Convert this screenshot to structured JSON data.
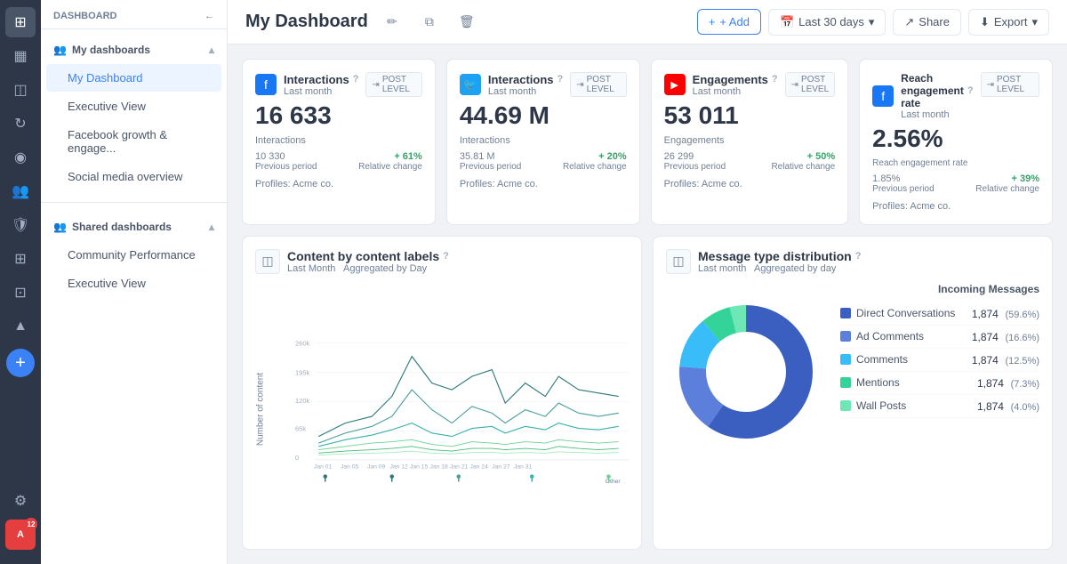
{
  "app": {
    "section_label": "DASHBOARD",
    "back_icon": "←"
  },
  "sidebar": {
    "my_dashboards_label": "My dashboards",
    "shared_dashboards_label": "Shared dashboards",
    "my_dashboard_items": [
      {
        "label": "My Dashboard",
        "active": true
      },
      {
        "label": "Executive View",
        "active": false
      },
      {
        "label": "Facebook growth & engage...",
        "active": false
      },
      {
        "label": "Social media overview",
        "active": false
      }
    ],
    "shared_dashboard_items": [
      {
        "label": "Community Performance",
        "active": false
      },
      {
        "label": "Executive View",
        "active": false
      }
    ]
  },
  "topbar": {
    "title": "My Dashboard",
    "add_label": "+ Add",
    "date_range_label": "Last 30 days",
    "share_label": "Share",
    "export_label": "Export"
  },
  "metrics": [
    {
      "icon_type": "facebook",
      "icon_text": "f",
      "title": "Interactions",
      "help": "?",
      "subtitle": "Last month",
      "badge": "POST LEVEL",
      "value": "16 633",
      "value_label": "Interactions",
      "prev_value": "10 330",
      "prev_label": "Previous period",
      "change": "+ 61%",
      "change_label": "Relative change",
      "profiles": "Profiles: Acme co."
    },
    {
      "icon_type": "twitter",
      "icon_text": "🐦",
      "title": "Interactions",
      "help": "?",
      "subtitle": "Last month",
      "badge": "POST LEVEL",
      "value": "44.69 M",
      "value_label": "Interactions",
      "prev_value": "35.81 M",
      "prev_label": "Previous period",
      "change": "+ 20%",
      "change_label": "Relative change",
      "profiles": "Profiles: Acme co."
    },
    {
      "icon_type": "youtube",
      "icon_text": "▶",
      "title": "Engagements",
      "help": "?",
      "subtitle": "Last month",
      "badge": "POST LEVEL",
      "value": "53 011",
      "value_label": "Engagements",
      "prev_value": "26 299",
      "prev_label": "Previous period",
      "change": "+ 50%",
      "change_label": "Relative change",
      "profiles": "Profiles: Acme co."
    },
    {
      "icon_type": "facebook",
      "icon_text": "f",
      "title": "Reach engagement rate",
      "help": "?",
      "subtitle": "Last month",
      "badge": "POST LEVEL",
      "value": "2.56%",
      "value_label": "Reach engagement rate",
      "prev_value": "1.85%",
      "prev_label": "Previous period",
      "change": "+ 39%",
      "change_label": "Relative change",
      "profiles": "Profiles: Acme co."
    }
  ],
  "content_chart": {
    "title": "Content by content labels",
    "help": "?",
    "subtitle": "Last Month",
    "subtitle2": "Aggregated by Day",
    "y_label": "Number of content",
    "y_ticks": [
      "260k",
      "195k",
      "120k",
      "65k",
      "0"
    ],
    "x_ticks": [
      "Jan 01",
      "Jan 05",
      "Jan 09",
      "Jan 12",
      "Jan 15",
      "Jan 18",
      "Jan 21",
      "Jan 24",
      "Jan 27",
      "Jan 31"
    ],
    "bottom_label": "Other"
  },
  "message_chart": {
    "title": "Message type distribution",
    "help": "?",
    "subtitle": "Last month",
    "subtitle2": "Aggregated by day",
    "incoming_label": "Incoming Messages",
    "legend": [
      {
        "label": "Direct Conversations",
        "value": "1,874",
        "pct": "(59.6%)",
        "color": "#3b5fc0"
      },
      {
        "label": "Ad Comments",
        "value": "1,874",
        "pct": "(16.6%)",
        "color": "#5b7fdb"
      },
      {
        "label": "Comments",
        "value": "1,874",
        "pct": "(12.5%)",
        "color": "#38bdf8"
      },
      {
        "label": "Mentions",
        "value": "1,874",
        "pct": "(7.3%)",
        "color": "#34d399"
      },
      {
        "label": "Wall Posts",
        "value": "1,874",
        "pct": "(4.0%)",
        "color": "#6ee7b7"
      }
    ]
  },
  "icons": {
    "edit": "✏",
    "copy": "⧉",
    "delete": "🗑",
    "calendar": "📅",
    "share": "↗",
    "download": "⬇",
    "chevron_down": "▾",
    "chevron_up": "▴",
    "chart_bar": "▦",
    "users": "👥",
    "layers": "⊞",
    "star": "★",
    "shield": "🛡",
    "robot": "🤖",
    "thumb": "👍",
    "settings": "⚙",
    "user_circle": "◉",
    "grid": "⊞",
    "refresh": "↻",
    "back": "←"
  }
}
